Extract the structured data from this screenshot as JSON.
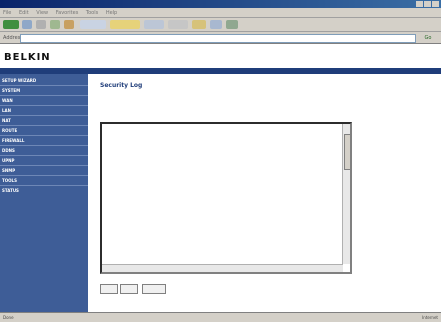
{
  "browser": {
    "title": "",
    "menu": [
      "File",
      "Edit",
      "View",
      "Favorites",
      "Tools",
      "Help"
    ],
    "address_label": "Address",
    "address_value": "",
    "go_label": "Go",
    "status_left": "Done",
    "status_right": "Internet"
  },
  "router": {
    "logo": "BELKIN",
    "tagline": "",
    "header_links": [
      "",
      "",
      ""
    ]
  },
  "sidebar": {
    "items": [
      {
        "label": "SETUP WIZARD",
        "sub": false
      },
      {
        "label": "SYSTEM",
        "sub": false
      },
      {
        "label": "WAN",
        "sub": false
      },
      {
        "label": "LAN",
        "sub": false
      },
      {
        "label": "NAT",
        "sub": false
      },
      {
        "label": "ROUTE",
        "sub": false
      },
      {
        "label": "FIREWALL",
        "sub": false
      },
      {
        "label": "DDNS",
        "sub": false
      },
      {
        "label": "UPNP",
        "sub": false
      },
      {
        "label": "SNMP",
        "sub": false
      },
      {
        "label": "TOOLS",
        "sub": false
      },
      {
        "label": "STATUS",
        "sub": false
      },
      {
        "label": "",
        "sub": true
      },
      {
        "label": "",
        "sub": true
      }
    ]
  },
  "main": {
    "title": "Security Log",
    "current_time": "",
    "description": "",
    "log_lines": [
      "",
      "",
      "",
      "",
      "",
      "",
      "",
      "",
      "",
      "",
      "",
      "",
      "",
      "",
      "",
      "",
      "",
      "",
      "",
      "",
      "",
      "",
      "",
      "",
      "",
      ""
    ],
    "buttons": [
      "",
      "",
      ""
    ]
  }
}
